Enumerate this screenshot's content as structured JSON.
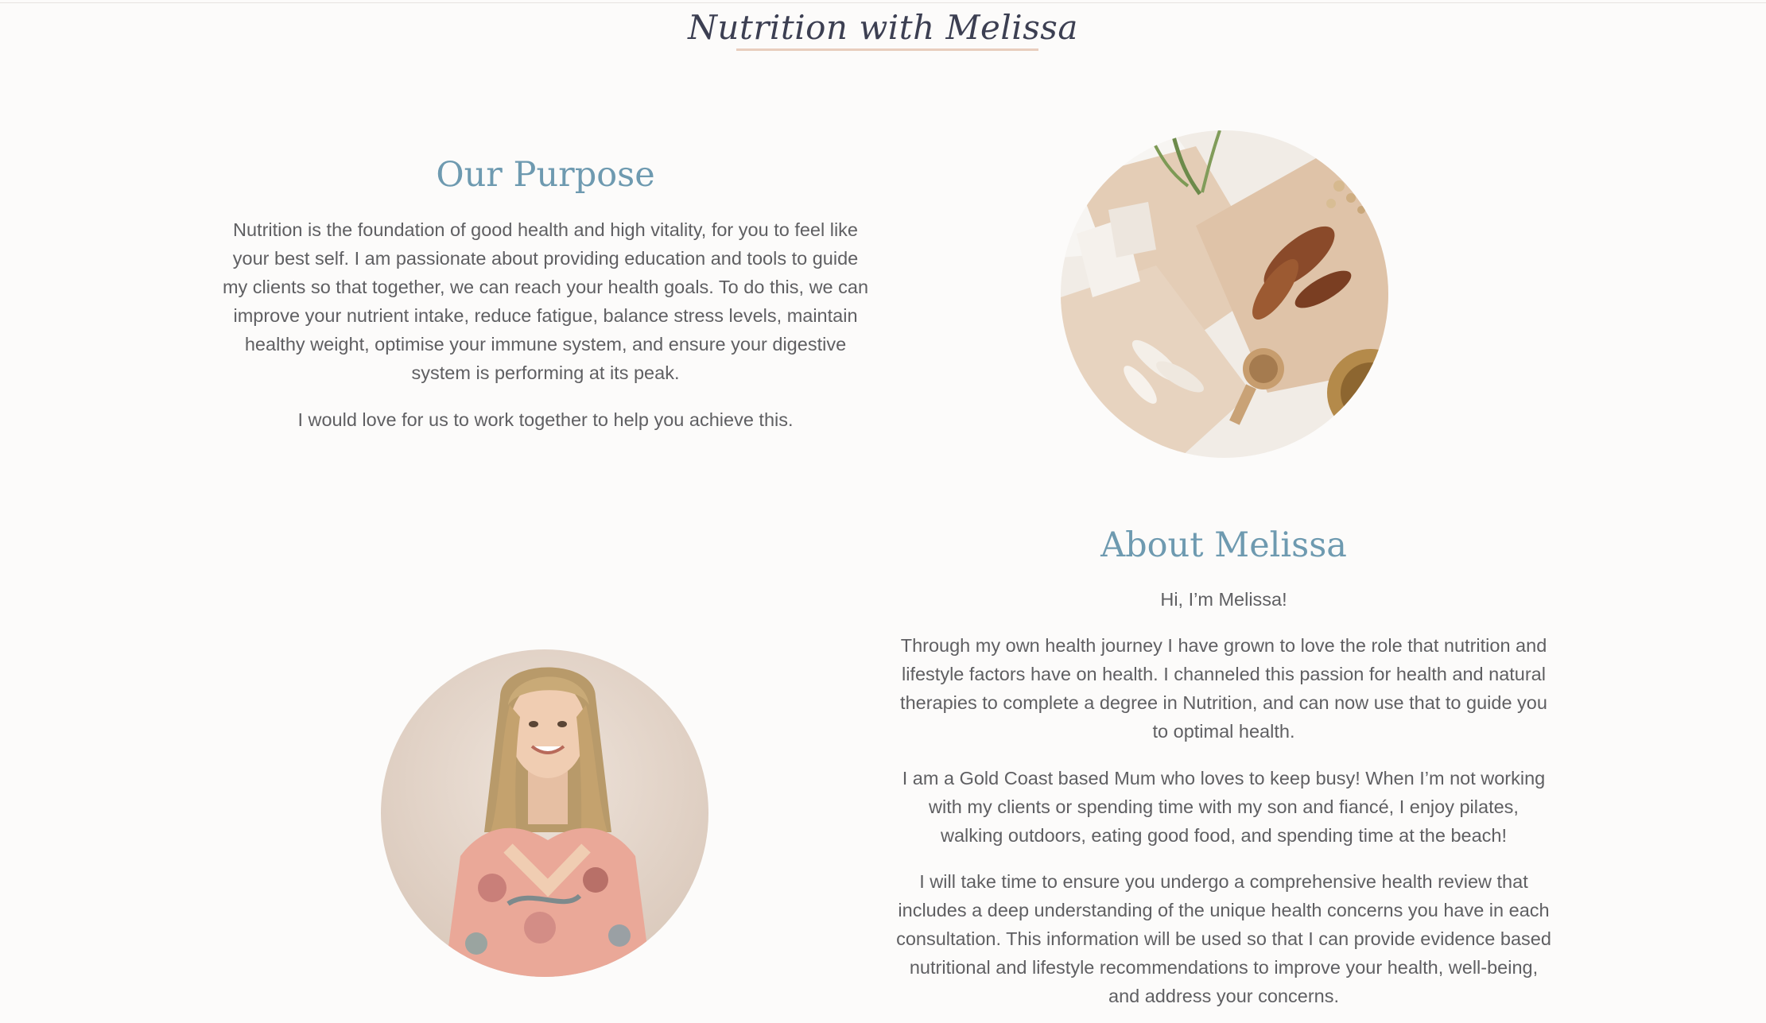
{
  "header": {
    "site_title": "Nutrition with Melissa"
  },
  "purpose": {
    "heading": "Our Purpose",
    "paragraphs": [
      "Nutrition is the foundation of good health and high vitality, for you to feel like your best self. I am passionate about providing education and tools to guide my clients so that together, we can reach your health goals. To do this, we can improve your nutrient intake, reduce fatigue, balance stress levels, maintain healthy weight, optimise your immune system, and ensure your digestive system is performing at its peak.",
      "I would love for us to work together to help you achieve this."
    ],
    "image": "herbs-on-paper-photo"
  },
  "about": {
    "heading": "About Melissa",
    "paragraphs": [
      "Hi, I’m Melissa!",
      "Through my own health journey I have grown to love the role that nutrition and lifestyle factors have on health. I channeled this passion for health and natural therapies to complete a degree in Nutrition, and can now use that to guide you to optimal health.",
      "I am a Gold Coast based Mum who loves to keep busy! When I’m not working with my clients or spending time with my son and fiancé, I enjoy pilates, walking outdoors, eating good food, and spending time at the beach!",
      "I will take time to ensure you undergo a comprehensive health review that includes a deep understanding of the unique health concerns you have in each consultation. This information will be used so that I can provide evidence based nutritional and lifestyle recommendations to improve your health, well-being, and address your concerns."
    ],
    "image": "melissa-portrait-photo"
  },
  "colors": {
    "background": "#fcfbfa",
    "title": "#3c3f52",
    "heading_accent": "#6e9ab0",
    "body_text": "#5f5f62",
    "underline": "#e8cdbd"
  }
}
